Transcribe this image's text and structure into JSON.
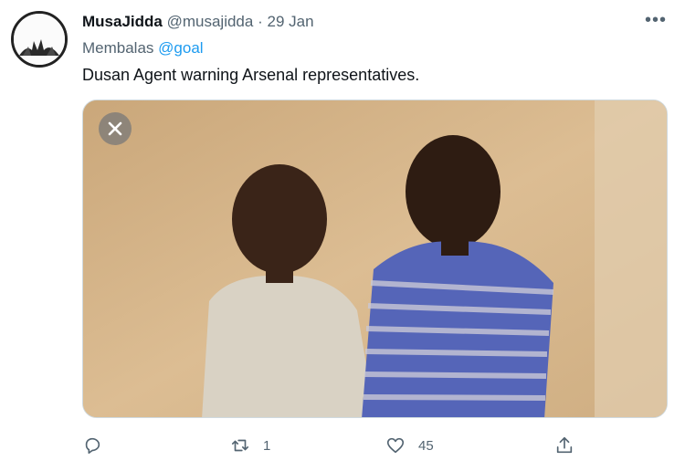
{
  "tweet": {
    "author_name": "MusaJidda",
    "handle": "@musajidda",
    "separator": "·",
    "date": "29 Jan",
    "reply_prefix": "Membalas",
    "reply_to": "@goal",
    "text": "Dusan Agent warning Arsenal representatives.",
    "more_icon": "more-icon"
  },
  "actions": {
    "reply_count": "",
    "retweet_count": "1",
    "like_count": "45"
  },
  "colors": {
    "accent": "#1d9bf0",
    "muted": "#536471",
    "text": "#0f1419"
  }
}
